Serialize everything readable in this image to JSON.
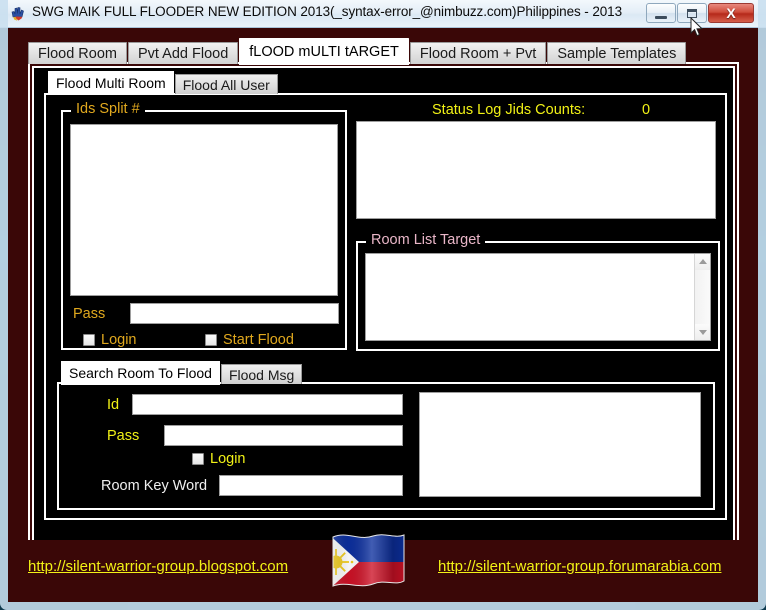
{
  "window": {
    "title": "SWG MAIK FULL FLOODER NEW EDITION 2013(_syntax-error_@nimbuzz.com)Philippines - 2013",
    "app_icon": "hand-icon",
    "minimize_label": "–",
    "maximize_label": "□",
    "close_label": "X"
  },
  "colors": {
    "client_background": "#3a0707",
    "panel_background": "#000000",
    "gold": "#e0a81e",
    "yellow": "#f2f216",
    "pink": "#e9b6c8",
    "white": "#ffffff",
    "close_button": "#b5291a"
  },
  "main_tabs": [
    {
      "label": "Flood Room",
      "active": false
    },
    {
      "label": "Pvt Add Flood",
      "active": false
    },
    {
      "label": "fLOOD mULTI tARGET",
      "active": true
    },
    {
      "label": "Flood Room + Pvt",
      "active": false
    },
    {
      "label": "Sample Templates",
      "active": false
    }
  ],
  "inner_tabs": [
    {
      "label": "Flood Multi Room",
      "active": true
    },
    {
      "label": "Flood All User",
      "active": false
    }
  ],
  "ids_split": {
    "group_title": "Ids Split #",
    "textarea_value": "",
    "pass_label": "Pass",
    "pass_value": "",
    "login_label": "Login",
    "login_checked": false,
    "start_flood_label": "Start Flood",
    "start_flood_checked": false
  },
  "status_log": {
    "label": "Status Log Jids Counts:",
    "count": "0",
    "textarea_value": ""
  },
  "room_list": {
    "group_title": "Room List Target",
    "textarea_value": "",
    "scroll_up_icon": "triangle-up-icon",
    "scroll_down_icon": "triangle-down-icon"
  },
  "bottom_tabs": [
    {
      "label": "Search Room To Flood",
      "active": true
    },
    {
      "label": "Flood Msg",
      "active": false
    }
  ],
  "search_room": {
    "id_label": "Id",
    "id_value": "",
    "pass_label": "Pass",
    "pass_value": "",
    "login_label": "Login",
    "login_checked": false,
    "keyword_label": "Room Key Word",
    "keyword_value": "",
    "output_value": ""
  },
  "footer": {
    "left_link": "http://silent-warrior-group.blogspot.com",
    "right_link": "http://silent-warrior-group.forumarabia.com",
    "flag": "philippines-flag"
  }
}
